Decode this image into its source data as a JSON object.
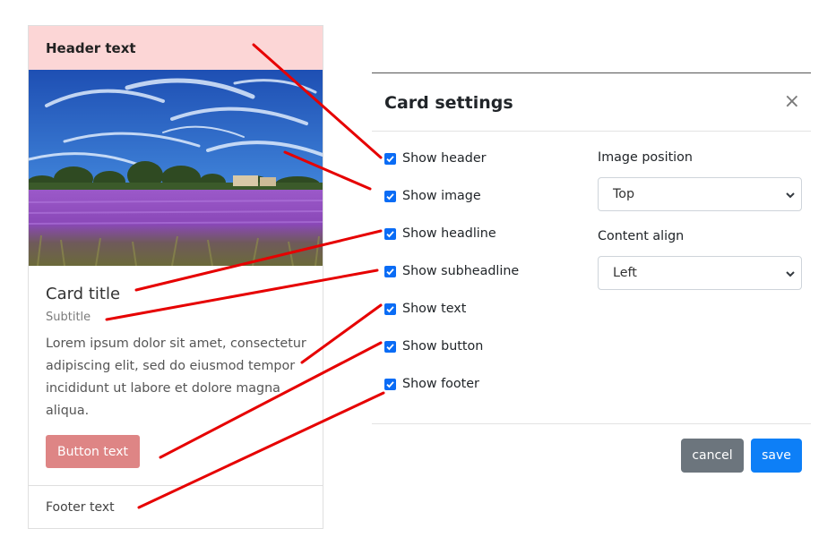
{
  "card": {
    "header_text": "Header text",
    "title": "Card title",
    "subtitle": "Subtitle",
    "text": "Lorem ipsum dolor sit amet, consectetur adipiscing elit, sed do eiusmod tempor incididunt ut labore et dolore magna aliqua.",
    "button_text": "Button text",
    "footer_text": "Footer text"
  },
  "dialog": {
    "title": "Card settings",
    "close_symbol": "×",
    "checkboxes": [
      {
        "label": "Show header",
        "checked": true
      },
      {
        "label": "Show image",
        "checked": true
      },
      {
        "label": "Show headline",
        "checked": true
      },
      {
        "label": "Show subheadline",
        "checked": true
      },
      {
        "label": "Show text",
        "checked": true
      },
      {
        "label": "Show button",
        "checked": true
      },
      {
        "label": "Show footer",
        "checked": true
      }
    ],
    "image_position": {
      "label": "Image position",
      "value": "Top"
    },
    "content_align": {
      "label": "Content align",
      "value": "Left"
    },
    "cancel_label": "cancel",
    "save_label": "save"
  },
  "colors": {
    "header_bg": "#fcd6d6",
    "button_bg": "#de8585",
    "checkbox": "#0a6cf5",
    "cancel": "#6c757d",
    "save": "#0d7ff7",
    "annotation_line": "#e60000"
  }
}
